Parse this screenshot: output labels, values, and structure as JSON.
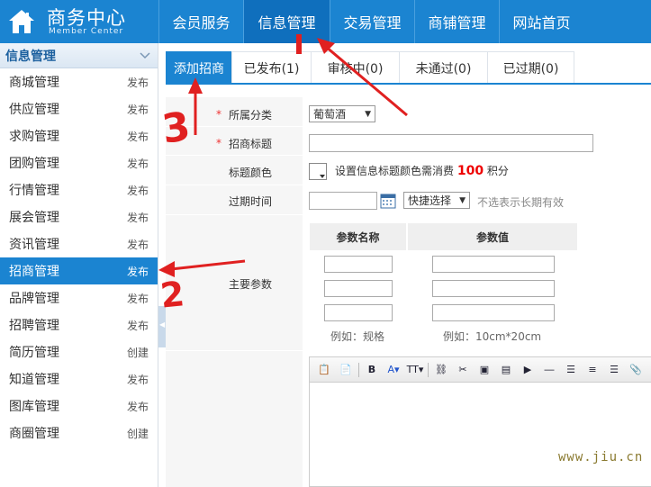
{
  "brand": {
    "title": "商务中心",
    "subtitle": "Member Center"
  },
  "nav": [
    {
      "label": "会员服务",
      "active": false,
      "width": 94
    },
    {
      "label": "信息管理",
      "active": true,
      "width": 96
    },
    {
      "label": "交易管理",
      "active": false,
      "width": 94
    },
    {
      "label": "商铺管理",
      "active": false,
      "width": 94
    },
    {
      "label": "网站首页",
      "active": false,
      "width": 94
    }
  ],
  "sidebar": {
    "title": "信息管理",
    "items": [
      {
        "label": "商城管理",
        "action": "发布"
      },
      {
        "label": "供应管理",
        "action": "发布"
      },
      {
        "label": "求购管理",
        "action": "发布"
      },
      {
        "label": "团购管理",
        "action": "发布"
      },
      {
        "label": "行情管理",
        "action": "发布"
      },
      {
        "label": "展会管理",
        "action": "发布"
      },
      {
        "label": "资讯管理",
        "action": "发布"
      },
      {
        "label": "招商管理",
        "action": "发布",
        "active": true
      },
      {
        "label": "品牌管理",
        "action": "发布"
      },
      {
        "label": "招聘管理",
        "action": "发布"
      },
      {
        "label": "简历管理",
        "action": "创建"
      },
      {
        "label": "知道管理",
        "action": "发布"
      },
      {
        "label": "图库管理",
        "action": "发布"
      },
      {
        "label": "商圈管理",
        "action": "创建"
      }
    ]
  },
  "tabs": [
    {
      "label": "添加招商",
      "active": true
    },
    {
      "label": "已发布(1)"
    },
    {
      "label": "审核中(0)"
    },
    {
      "label": "未通过(0)"
    },
    {
      "label": "已过期(0)"
    }
  ],
  "form": {
    "category_label": "所属分类",
    "category_value": "葡萄酒",
    "title_label": "招商标题",
    "color_label": "标题颜色",
    "color_hint_prefix": "设置信息标题颜色需消费",
    "color_hint_cost": "100",
    "color_hint_suffix": "积分",
    "expire_label": "过期时间",
    "expire_select": "快捷选择",
    "expire_hint": "不选表示长期有效",
    "params_label": "主要参数",
    "param_name_header": "参数名称",
    "param_value_header": "参数值",
    "param_name_example": "例如：规格",
    "param_value_example": "例如：10cm*20cm",
    "required_mark": "*"
  },
  "editor_toolbar": [
    "paste-icon",
    "paste-text-icon",
    "bold-icon",
    "font-color-icon",
    "font-size-icon",
    "link-icon",
    "unlink-icon",
    "image-icon",
    "image-upload-icon",
    "flash-icon",
    "hr-icon",
    "align-left-icon",
    "align-center-icon",
    "align-right-icon",
    "attach-icon"
  ],
  "annotations": [
    "3",
    "2"
  ],
  "watermark": "www.jiu.cn"
}
